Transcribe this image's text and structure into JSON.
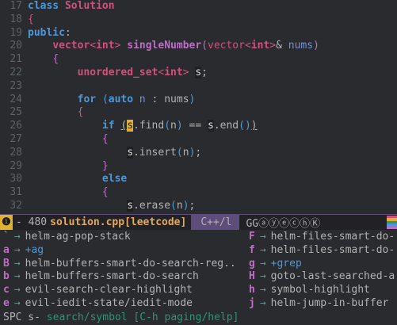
{
  "editor": {
    "lines": [
      {
        "num": "17",
        "indent": 0,
        "tokens": [
          {
            "t": "class",
            "c": "kw"
          },
          {
            "t": " ",
            "c": "plain"
          },
          {
            "t": "Solution",
            "c": "type"
          }
        ]
      },
      {
        "num": "18",
        "indent": 0,
        "tokens": [
          {
            "t": "{",
            "c": "br2"
          }
        ]
      },
      {
        "num": "19",
        "indent": 0,
        "tokens": [
          {
            "t": "public",
            "c": "kw"
          },
          {
            "t": ":",
            "c": "plain"
          }
        ]
      },
      {
        "num": "20",
        "indent": 4,
        "tokens": [
          {
            "t": "vector",
            "c": "type"
          },
          {
            "t": "<",
            "c": "tmpl"
          },
          {
            "t": "int",
            "c": "type"
          },
          {
            "t": ">",
            "c": "tmpl"
          },
          {
            "t": " ",
            "c": "plain"
          },
          {
            "t": "singleNumber",
            "c": "fn"
          },
          {
            "t": "(",
            "c": "br3"
          },
          {
            "t": "vector",
            "c": "tmpl"
          },
          {
            "t": "<",
            "c": "tmpl"
          },
          {
            "t": "int",
            "c": "type"
          },
          {
            "t": ">",
            "c": "tmpl"
          },
          {
            "t": "& ",
            "c": "plain"
          },
          {
            "t": "nums",
            "c": "var"
          },
          {
            "t": ")",
            "c": "br3"
          }
        ]
      },
      {
        "num": "21",
        "indent": 4,
        "tokens": [
          {
            "t": "{",
            "c": "br3"
          }
        ]
      },
      {
        "num": "22",
        "indent": 8,
        "tokens": [
          {
            "t": "unordered_set",
            "c": "type"
          },
          {
            "t": "<",
            "c": "tmpl"
          },
          {
            "t": "int",
            "c": "type"
          },
          {
            "t": ">",
            "c": "tmpl"
          },
          {
            "t": " ",
            "c": "plain"
          },
          {
            "t": "s",
            "c": "cursor-hl"
          },
          {
            "t": ";",
            "c": "plain"
          }
        ]
      },
      {
        "num": "23",
        "indent": 0,
        "tokens": []
      },
      {
        "num": "24",
        "indent": 8,
        "tokens": [
          {
            "t": "for",
            "c": "kw"
          },
          {
            "t": " ",
            "c": "plain"
          },
          {
            "t": "(",
            "c": "br1"
          },
          {
            "t": "auto",
            "c": "kw"
          },
          {
            "t": " ",
            "c": "plain"
          },
          {
            "t": "n",
            "c": "var"
          },
          {
            "t": " : nums",
            "c": "plain"
          },
          {
            "t": ")",
            "c": "br1"
          }
        ]
      },
      {
        "num": "25",
        "indent": 8,
        "tokens": [
          {
            "t": "{",
            "c": "br2"
          }
        ]
      },
      {
        "num": "26",
        "indent": 12,
        "tokens": [
          {
            "t": "if",
            "c": "kw"
          },
          {
            "t": " ",
            "c": "plain"
          },
          {
            "t": "(",
            "c": "paren-hl"
          },
          {
            "t": "s",
            "c": "match-hl"
          },
          {
            "t": ".find",
            "c": "plain"
          },
          {
            "t": "(",
            "c": "br1"
          },
          {
            "t": "n",
            "c": "plain"
          },
          {
            "t": ")",
            "c": "br1"
          },
          {
            "t": " == ",
            "c": "plain"
          },
          {
            "t": "s",
            "c": "cursor-hl"
          },
          {
            "t": ".end",
            "c": "plain"
          },
          {
            "t": "()",
            "c": "br1"
          },
          {
            "t": ")",
            "c": "paren-hl"
          }
        ]
      },
      {
        "num": "27",
        "indent": 12,
        "tokens": [
          {
            "t": "{",
            "c": "br3"
          }
        ]
      },
      {
        "num": "28",
        "indent": 16,
        "tokens": [
          {
            "t": "s",
            "c": "cursor-hl"
          },
          {
            "t": ".insert",
            "c": "plain"
          },
          {
            "t": "(",
            "c": "br1"
          },
          {
            "t": "n",
            "c": "plain"
          },
          {
            "t": ")",
            "c": "br1"
          },
          {
            "t": ";",
            "c": "plain"
          }
        ]
      },
      {
        "num": "29",
        "indent": 12,
        "tokens": [
          {
            "t": "}",
            "c": "br3"
          }
        ]
      },
      {
        "num": "30",
        "indent": 12,
        "tokens": [
          {
            "t": "else",
            "c": "kw"
          }
        ]
      },
      {
        "num": "31",
        "indent": 12,
        "tokens": [
          {
            "t": "{",
            "c": "br3"
          }
        ]
      },
      {
        "num": "32",
        "indent": 16,
        "tokens": [
          {
            "t": "s",
            "c": "cursor-hl"
          },
          {
            "t": ".erase",
            "c": "plain"
          },
          {
            "t": "(",
            "c": "br1"
          },
          {
            "t": "n",
            "c": "plain"
          },
          {
            "t": ")",
            "c": "br1"
          },
          {
            "t": ";",
            "c": "plain"
          }
        ]
      }
    ]
  },
  "modeline": {
    "state_indicator": "❶",
    "position": "- 480",
    "file_name": "solution.cpp",
    "project": "[leetcode]",
    "major_mode": "C++/l",
    "minor_modes": "GGⓐⓨⓔⓒⓗⓀ",
    "rainbow_colors": [
      "#ce537a",
      "#e0b030",
      "#2d9574",
      "#4f97d7",
      "#bc6ec5"
    ]
  },
  "which_key": {
    "rows": [
      {
        "lk": "`",
        "lc": "helm-ag-pop-stack",
        "lg": false,
        "rk": "F",
        "rc": "helm-files-smart-do-",
        "rg": false
      },
      {
        "lk": "a",
        "lc": "+ag",
        "lg": true,
        "rk": "f",
        "rc": "helm-files-smart-do-",
        "rg": false
      },
      {
        "lk": "B",
        "lc": "helm-buffers-smart-do-search-reg..",
        "lg": false,
        "rk": "g",
        "rc": "+grep",
        "rg": true
      },
      {
        "lk": "b",
        "lc": "helm-buffers-smart-do-search",
        "lg": false,
        "rk": "H",
        "rc": "goto-last-searched-a",
        "rg": false
      },
      {
        "lk": "c",
        "lc": "evil-search-clear-highlight",
        "lg": false,
        "rk": "h",
        "rc": "symbol-highlight",
        "rg": false
      },
      {
        "lk": "e",
        "lc": "evil-iedit-state/iedit-mode",
        "lg": false,
        "rk": "j",
        "rc": "helm-jump-in-buffer",
        "rg": false
      }
    ],
    "arrow": "→"
  },
  "echo": {
    "prefix": "SPC s-",
    "description": "search/symbol [C-h paging/help]"
  }
}
